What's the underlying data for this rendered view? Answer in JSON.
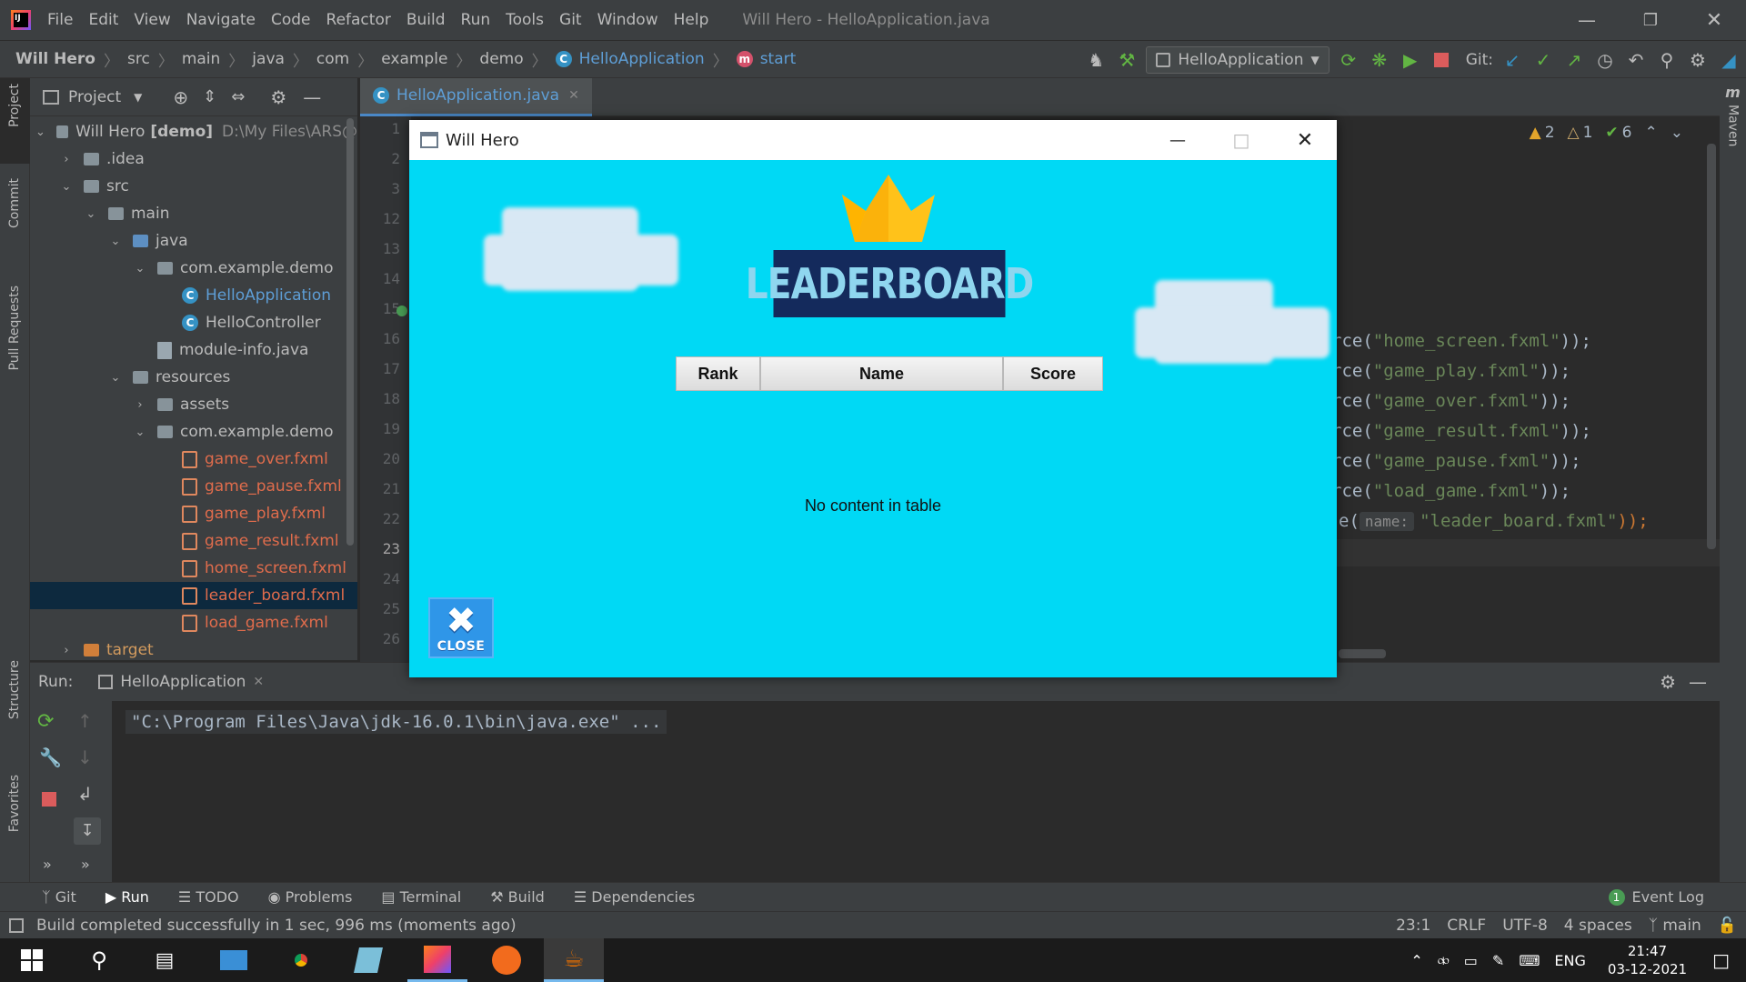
{
  "window": {
    "menus": [
      "File",
      "Edit",
      "View",
      "Navigate",
      "Code",
      "Refactor",
      "Build",
      "Run",
      "Tools",
      "Git",
      "Window",
      "Help"
    ],
    "title": "Will Hero - HelloApplication.java"
  },
  "breadcrumb": [
    "Will Hero",
    "src",
    "main",
    "java",
    "com",
    "example",
    "demo",
    "HelloApplication",
    "start"
  ],
  "run_config": "HelloApplication",
  "git_label": "Git:",
  "left_tools": [
    "Project",
    "Commit",
    "Pull Requests",
    "Structure",
    "Favorites"
  ],
  "right_tools": [
    "Maven"
  ],
  "project": {
    "header": "Project",
    "root_name": "Will Hero",
    "root_module": "[demo]",
    "root_path": "D:\\My Files\\ARS@",
    "tree": [
      {
        "label": ".idea",
        "level": 1,
        "type": "folder",
        "expanded": false
      },
      {
        "label": "src",
        "level": 1,
        "type": "folder",
        "expanded": true
      },
      {
        "label": "main",
        "level": 2,
        "type": "folder",
        "expanded": true
      },
      {
        "label": "java",
        "level": 3,
        "type": "folder-blue",
        "expanded": true
      },
      {
        "label": "com.example.demo",
        "level": 4,
        "type": "package",
        "expanded": true
      },
      {
        "label": "HelloApplication",
        "level": 5,
        "type": "class",
        "selected_style": "link"
      },
      {
        "label": "HelloController",
        "level": 5,
        "type": "class"
      },
      {
        "label": "module-info.java",
        "level": 4,
        "type": "java"
      },
      {
        "label": "resources",
        "level": 3,
        "type": "folder",
        "expanded": true
      },
      {
        "label": "assets",
        "level": 4,
        "type": "folder",
        "expanded": false
      },
      {
        "label": "com.example.demo",
        "level": 4,
        "type": "package",
        "expanded": true
      },
      {
        "label": "game_over.fxml",
        "level": 5,
        "type": "fxml"
      },
      {
        "label": "game_pause.fxml",
        "level": 5,
        "type": "fxml"
      },
      {
        "label": "game_play.fxml",
        "level": 5,
        "type": "fxml"
      },
      {
        "label": "game_result.fxml",
        "level": 5,
        "type": "fxml"
      },
      {
        "label": "home_screen.fxml",
        "level": 5,
        "type": "fxml"
      },
      {
        "label": "leader_board.fxml",
        "level": 5,
        "type": "fxml",
        "selected": true
      },
      {
        "label": "load_game.fxml",
        "level": 5,
        "type": "fxml"
      },
      {
        "label": "target",
        "level": 1,
        "type": "folder-orange",
        "expanded": false
      }
    ]
  },
  "editor": {
    "tab": "HelloApplication.java",
    "line_numbers": [
      "1",
      "2",
      "3",
      "12",
      "13",
      "14",
      "15",
      "16",
      "17",
      "18",
      "19",
      "20",
      "21",
      "22",
      "23",
      "24",
      "25",
      "26"
    ],
    "current_line": "23",
    "inspections": {
      "warnings": "2",
      "weak_warnings": "1",
      "ok": "6"
    },
    "code": {
      "l16_pre": "rce(",
      "l16_str": "\"home_screen.fxml\"",
      "l16_post": "));",
      "l17_pre": "rce(",
      "l17_str": "\"game_play.fxml\"",
      "l17_post": "));",
      "l18_pre": "rce(",
      "l18_str": "\"game_over.fxml\"",
      "l18_post": "));",
      "l19_pre": "rce(",
      "l19_str": "\"game_result.fxml\"",
      "l19_post": "));",
      "l20_pre": "rce(",
      "l20_str": "\"game_pause.fxml\"",
      "l20_post": "));",
      "l21_pre": "rce(",
      "l21_str": "\"load_game.fxml\"",
      "l21_post": "));",
      "l22_pre": "e(",
      "l22_hint": "name:",
      "l22_str": "\"leader_board.fxml\"",
      "l22_post": "));"
    }
  },
  "run": {
    "label": "Run:",
    "tab": "HelloApplication",
    "console": "\"C:\\Program Files\\Java\\jdk-16.0.1\\bin\\java.exe\" ..."
  },
  "bottom_tabs": [
    "Git",
    "Run",
    "TODO",
    "Problems",
    "Terminal",
    "Build",
    "Dependencies"
  ],
  "event_log": {
    "count": "1",
    "label": "Event Log"
  },
  "status": {
    "message": "Build completed successfully in 1 sec, 996 ms (moments ago)",
    "position": "23:1",
    "line_sep": "CRLF",
    "encoding": "UTF-8",
    "indent": "4 spaces",
    "branch": "main"
  },
  "game": {
    "window_title": "Will Hero",
    "banner": "LEADERBOARD",
    "columns": [
      "Rank",
      "Name",
      "Score"
    ],
    "empty_text": "No content in table",
    "close_label": "CLOSE",
    "colors": {
      "background": "#00d9f5",
      "banner": "#142a5c",
      "banner_text": "#8fd6ef",
      "close_button": "#2f96e8"
    }
  },
  "taskbar": {
    "lang": "ENG",
    "time": "21:47",
    "date": "03-12-2021"
  }
}
